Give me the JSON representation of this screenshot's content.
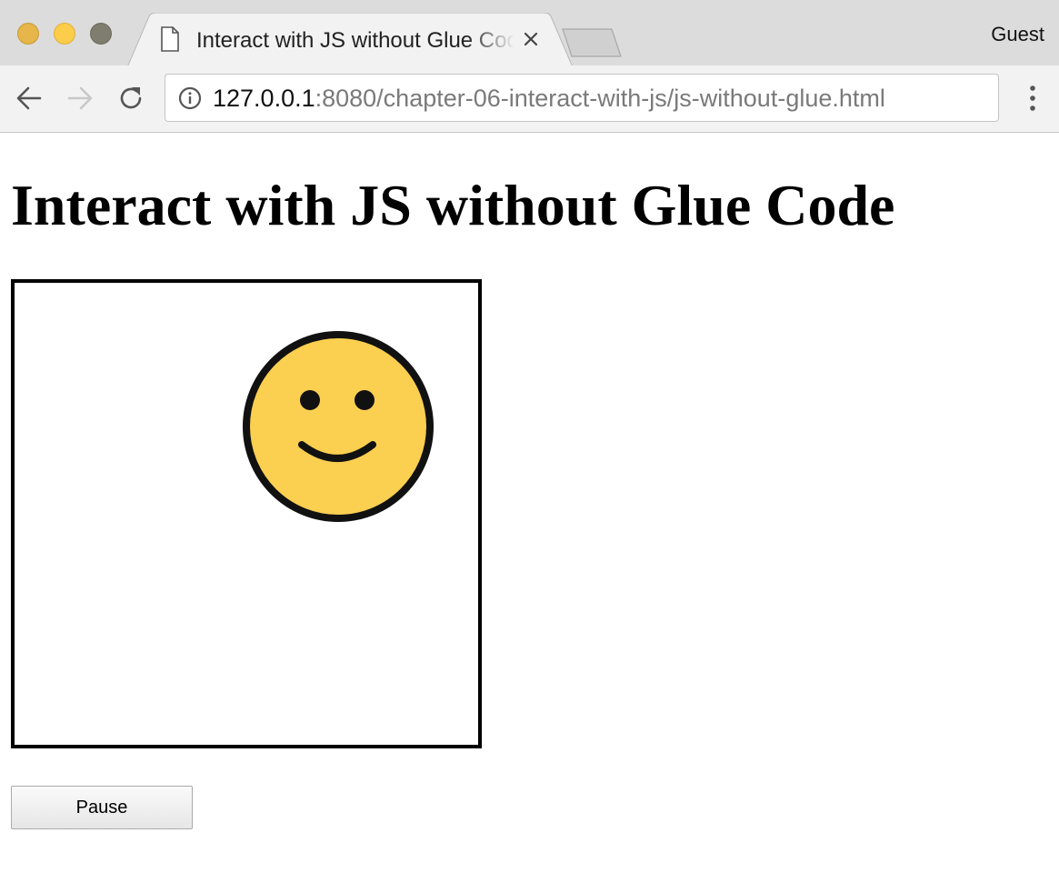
{
  "browser": {
    "tab": {
      "title": "Interact with JS without Glue Code",
      "page_icon": "page-icon",
      "close_icon": "close-icon"
    },
    "profile_label": "Guest",
    "address_bar": {
      "host": "127.0.0.1",
      "rest": ":8080/chapter-06-interact-with-js/js-without-glue.html",
      "security_icon": "info-icon"
    },
    "nav_icons": [
      "back-arrow-icon",
      "forward-arrow-icon",
      "reload-icon",
      "kebab-menu-icon"
    ]
  },
  "page": {
    "heading": "Interact with JS without Glue Code",
    "canvas": {
      "sprite": "smiley-face",
      "sprite_color": "#fbcf50"
    },
    "pause_button_label": "Pause"
  }
}
